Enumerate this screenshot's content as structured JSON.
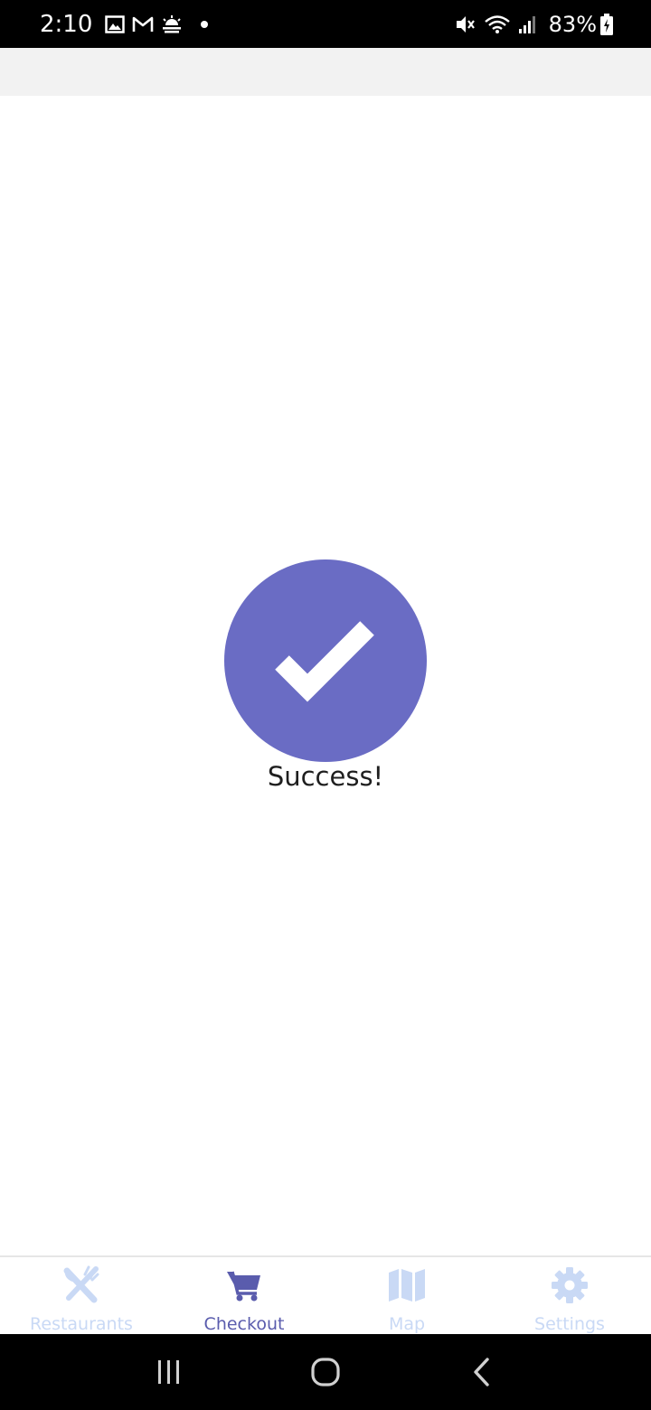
{
  "status_bar": {
    "time": "2:10",
    "battery": "83%",
    "icons": [
      "image-icon",
      "gmail-icon",
      "weather-icon",
      "notification-dot",
      "mute-icon",
      "wifi-icon",
      "signal-icon",
      "battery-icon"
    ]
  },
  "main": {
    "success_text": "Success!",
    "badge_icon": "checkmark-icon",
    "accent_color": "#6a6cc4"
  },
  "tabs": [
    {
      "label": "Restaurants",
      "icon": "utensils-icon",
      "active": false
    },
    {
      "label": "Checkout",
      "icon": "cart-icon",
      "active": true
    },
    {
      "label": "Map",
      "icon": "map-icon",
      "active": false
    },
    {
      "label": "Settings",
      "icon": "gear-icon",
      "active": false
    }
  ],
  "colors": {
    "active_tab": "#5a5cad",
    "inactive_tab": "#c9d9f5"
  },
  "nav_bar": {
    "buttons": [
      "recents-icon",
      "home-icon",
      "back-icon"
    ]
  }
}
